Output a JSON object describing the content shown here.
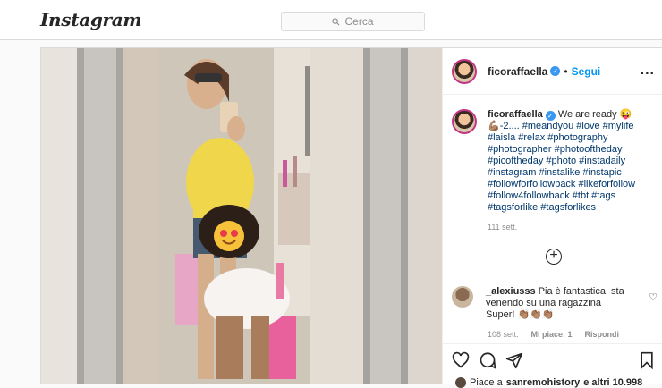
{
  "topbar": {
    "logo": "Instagram",
    "search_placeholder": "Cerca"
  },
  "post": {
    "username": "ficoraffaella",
    "dot": "•",
    "follow_label": "Segui",
    "more_label": "...",
    "caption": {
      "username": "ficoraffaella",
      "text": "We are ready 😜",
      "tags": "💪🏽-2.... #meandyou #love #mylife #laisla #relax #photography #photographer #photooftheday #picoftheday #photo #instadaily #instagram #instalike #instapic #followforfollowback #likeforfollow #follow4followback #tbt #tags #tagsforlike #tagsforlikes",
      "time": "111 sett."
    },
    "load_more_label": "+",
    "comment": {
      "username": "_alexiusss",
      "text": "Pia è fantastica, sta venendo su una ragazzina Super! 👏🏽👏🏽👏🏽",
      "time": "108 sett.",
      "likes": "Mi piace: 1",
      "reply": "Rispondi"
    },
    "likes_line": {
      "prefix": "Piace a",
      "user": "sanremohistory",
      "rest": "e altri 10.998"
    }
  }
}
